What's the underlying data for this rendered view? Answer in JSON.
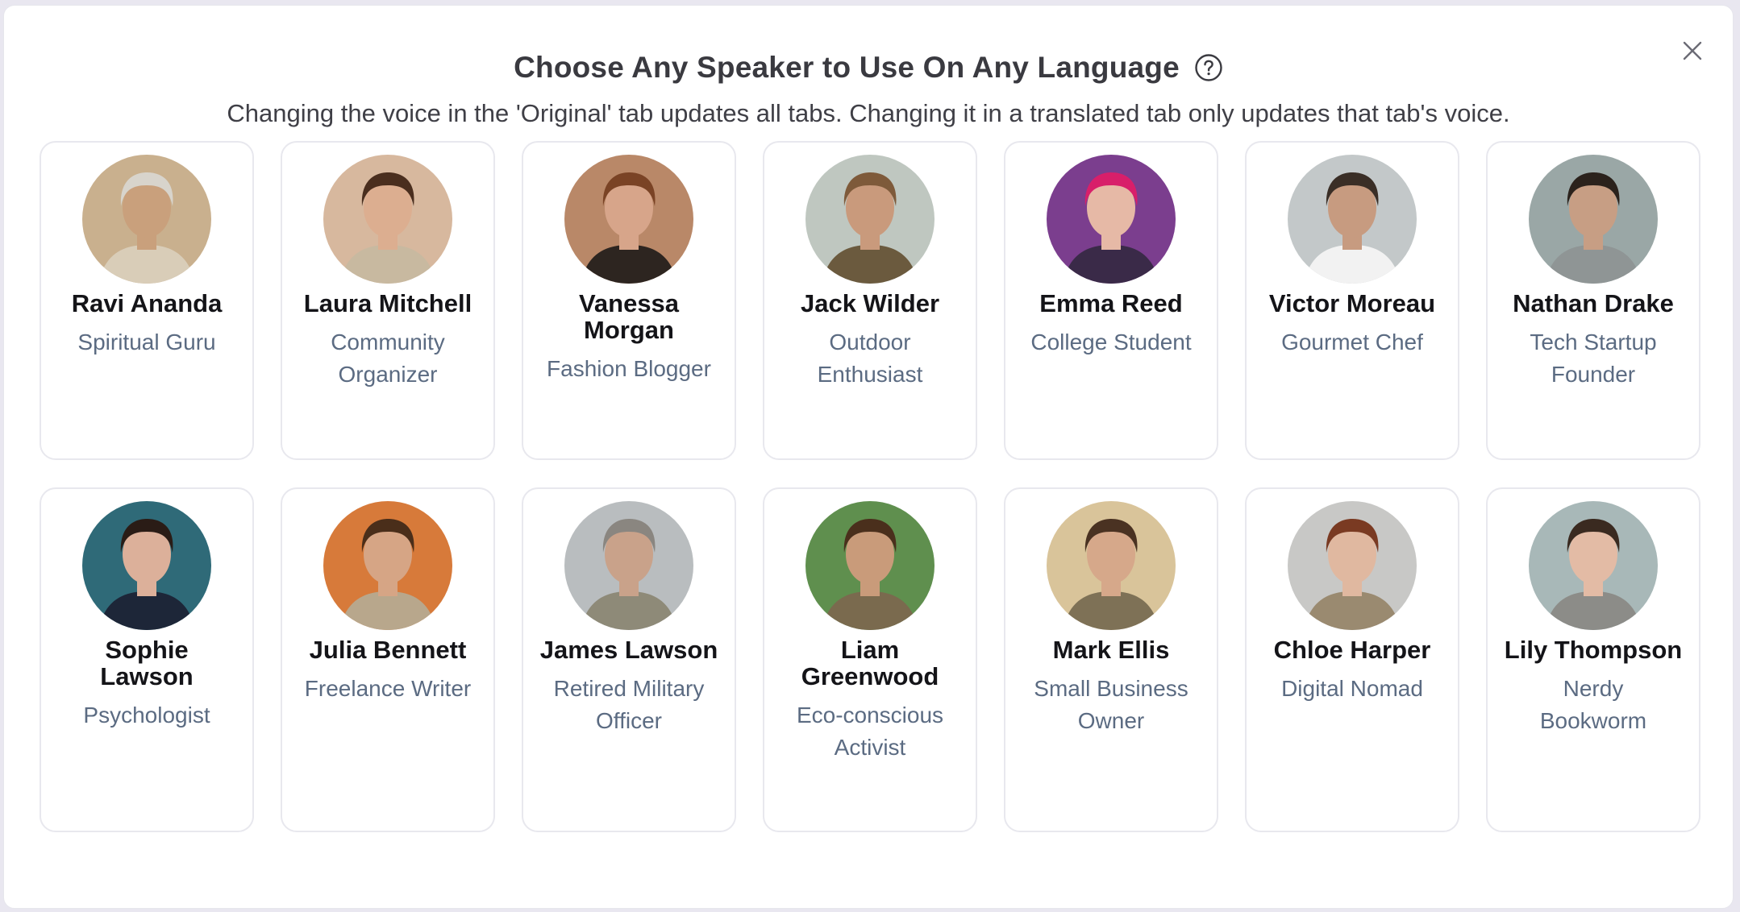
{
  "dialog": {
    "title": "Choose Any Speaker to Use On Any Language",
    "subtitle": "Changing the voice in the 'Original' tab updates all tabs. Changing it in a translated tab only updates that tab's voice.",
    "help_icon": "question-circle-icon",
    "close_icon": "close-icon"
  },
  "speakers": [
    {
      "name": "Ravi Ananda",
      "role": "Spiritual Guru",
      "bg": "#c9b08e",
      "skin": "#c9a07c",
      "hair": "#d8d4cc",
      "shirt": "#d9cdb8"
    },
    {
      "name": "Laura Mitchell",
      "role": "Community Organizer",
      "bg": "#d7b89e",
      "skin": "#dcae90",
      "hair": "#4a2e1e",
      "shirt": "#c8b9a0"
    },
    {
      "name": "Vanessa Morgan",
      "role": "Fashion Blogger",
      "bg": "#b98868",
      "skin": "#d7a58a",
      "hair": "#7a4325",
      "shirt": "#2d2520"
    },
    {
      "name": "Jack Wilder",
      "role": "Outdoor Enthusiast",
      "bg": "#bfc7c0",
      "skin": "#c99a7c",
      "hair": "#7e5a3a",
      "shirt": "#6b5a3e"
    },
    {
      "name": "Emma Reed",
      "role": "College Student",
      "bg": "#7b3e8e",
      "skin": "#e6b9a6",
      "hair": "#d81f6a",
      "shirt": "#3a2a48"
    },
    {
      "name": "Victor Moreau",
      "role": "Gourmet Chef",
      "bg": "#c3c8c9",
      "skin": "#c79b80",
      "hair": "#3a2e26",
      "shirt": "#f2f2f2"
    },
    {
      "name": "Nathan Drake",
      "role": "Tech Startup Founder",
      "bg": "#9aa7a6",
      "skin": "#c79e84",
      "hair": "#2b221c",
      "shirt": "#8f9595"
    },
    {
      "name": "Sophie Lawson",
      "role": "Psychologist",
      "bg": "#2f6a78",
      "skin": "#dcb09a",
      "hair": "#2a1c16",
      "shirt": "#1d2638"
    },
    {
      "name": "Julia Bennett",
      "role": "Freelance Writer",
      "bg": "#d77a3a",
      "skin": "#d6a585",
      "hair": "#4a2e1a",
      "shirt": "#b8a78c"
    },
    {
      "name": "James Lawson",
      "role": "Retired Military Officer",
      "bg": "#b9bdbf",
      "skin": "#c9a28a",
      "hair": "#8a8680",
      "shirt": "#8e8a78"
    },
    {
      "name": "Liam Greenwood",
      "role": "Eco-conscious Activist",
      "bg": "#5f8f4e",
      "skin": "#c99b7a",
      "hair": "#4a2f1c",
      "shirt": "#7a6a4e"
    },
    {
      "name": "Mark Ellis",
      "role": "Small Business Owner",
      "bg": "#d9c49a",
      "skin": "#d6a88a",
      "hair": "#4a3222",
      "shirt": "#7e7156"
    },
    {
      "name": "Chloe Harper",
      "role": "Digital Nomad",
      "bg": "#c8c8c6",
      "skin": "#e0b8a0",
      "hair": "#7a3a22",
      "shirt": "#9a8a70"
    },
    {
      "name": "Lily Thompson",
      "role": "Nerdy Bookworm",
      "bg": "#a8b8b8",
      "skin": "#e3bba5",
      "hair": "#3a2a20",
      "shirt": "#8c8c88"
    }
  ]
}
